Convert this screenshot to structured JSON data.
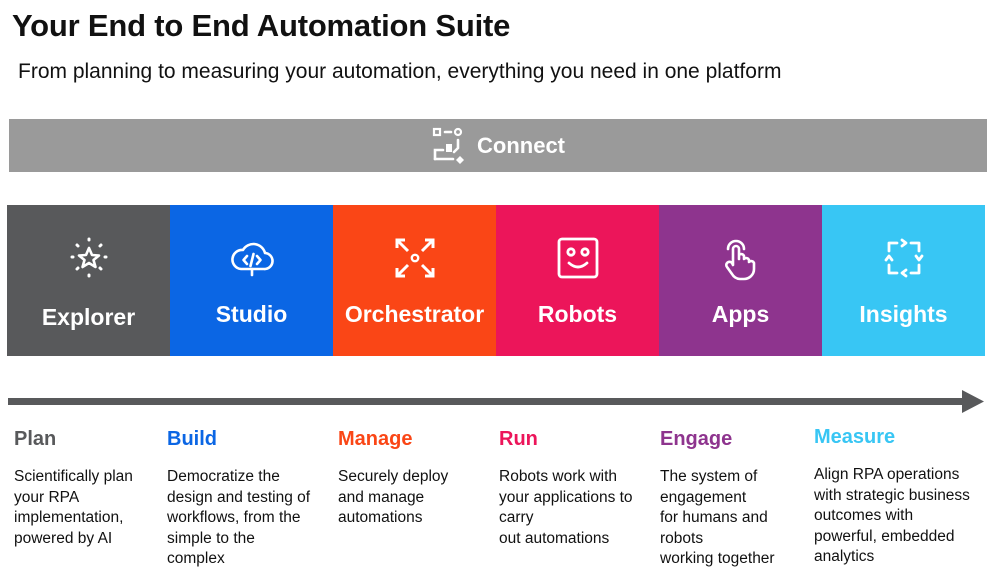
{
  "header": {
    "title": "Your End to End Automation Suite",
    "subtitle": "From planning to measuring your automation, everything you need in one platform"
  },
  "connect": {
    "label": "Connect",
    "icon": "workflow-nodes-icon",
    "color": "#9a9a9a"
  },
  "products": [
    {
      "name": "Explorer",
      "icon": "sparkle-star-icon",
      "color": "#58595b"
    },
    {
      "name": "Studio",
      "icon": "cloud-code-icon",
      "color": "#0b66e4"
    },
    {
      "name": "Orchestrator",
      "icon": "expand-arrows-icon",
      "color": "#fa4616"
    },
    {
      "name": "Robots",
      "icon": "robot-face-icon",
      "color": "#ec155a"
    },
    {
      "name": "Apps",
      "icon": "hand-pointer-icon",
      "color": "#8e348e"
    },
    {
      "name": "Insights",
      "icon": "cycle-arrows-icon",
      "color": "#38c6f4"
    }
  ],
  "stages": [
    {
      "title": "Plan",
      "color": "#58595b",
      "description": "Scientifically plan\nyour RPA\nimplementation,\npowered by AI"
    },
    {
      "title": "Build",
      "color": "#0b66e4",
      "description": "Democratize the\ndesign and testing of\nworkflows, from the\nsimple to the\ncomplex"
    },
    {
      "title": "Manage",
      "color": "#fa4616",
      "description": "Securely deploy\nand manage\nautomations"
    },
    {
      "title": "Run",
      "color": "#ec155a",
      "description": "Robots work with\nyour applications to\ncarry\nout automations"
    },
    {
      "title": "Engage",
      "color": "#8e348e",
      "description": "The system of\nengagement\nfor humans and\nrobots\nworking together"
    },
    {
      "title": "Measure",
      "color": "#38c6f4",
      "description": "Align RPA operations\nwith strategic business\noutcomes with\npowerful, embedded\nanalytics"
    }
  ],
  "timeline": {
    "color": "#58595b",
    "direction": "left-to-right"
  }
}
